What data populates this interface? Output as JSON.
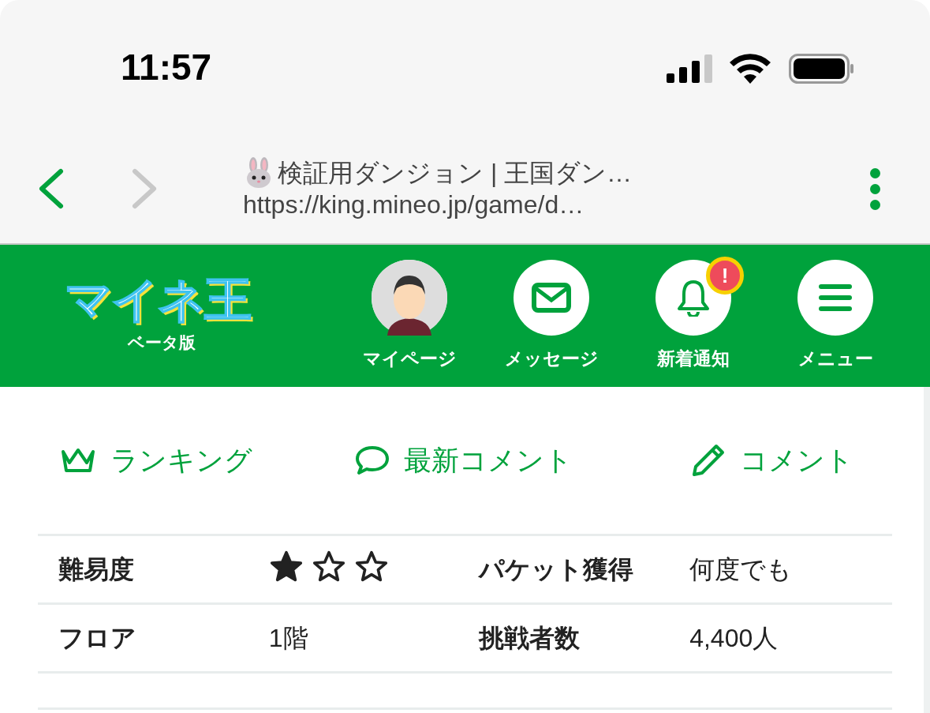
{
  "status_bar": {
    "time": "11:57"
  },
  "browser": {
    "title": "検証用ダンジョン | 王国ダン…",
    "url": "https://king.mineo.jp/game/d…",
    "back_disabled": false,
    "forward_disabled": true
  },
  "header": {
    "logo": "マイネ王",
    "logo_sub": "ベータ版",
    "items": [
      {
        "kind": "avatar",
        "label": "マイページ"
      },
      {
        "kind": "mail",
        "label": "メッセージ"
      },
      {
        "kind": "bell",
        "label": "新着通知",
        "badge": "!"
      },
      {
        "kind": "menu",
        "label": "メニュー"
      }
    ]
  },
  "links": [
    {
      "kind": "crown",
      "label": "ランキング"
    },
    {
      "kind": "speech",
      "label": "最新コメント"
    },
    {
      "kind": "pencil",
      "label": "コメント"
    }
  ],
  "table": {
    "rows": [
      {
        "cells": [
          {
            "kind": "label",
            "text": "難易度"
          },
          {
            "kind": "stars",
            "stars": 1
          },
          {
            "kind": "label",
            "text": "パケット獲得"
          },
          {
            "kind": "text",
            "text": "何度でも"
          }
        ]
      },
      {
        "cells": [
          {
            "kind": "label",
            "text": "フロア"
          },
          {
            "kind": "text",
            "text": "1階"
          },
          {
            "kind": "label",
            "text": "挑戦者数"
          },
          {
            "kind": "text",
            "text": "4,400人"
          }
        ]
      }
    ]
  }
}
